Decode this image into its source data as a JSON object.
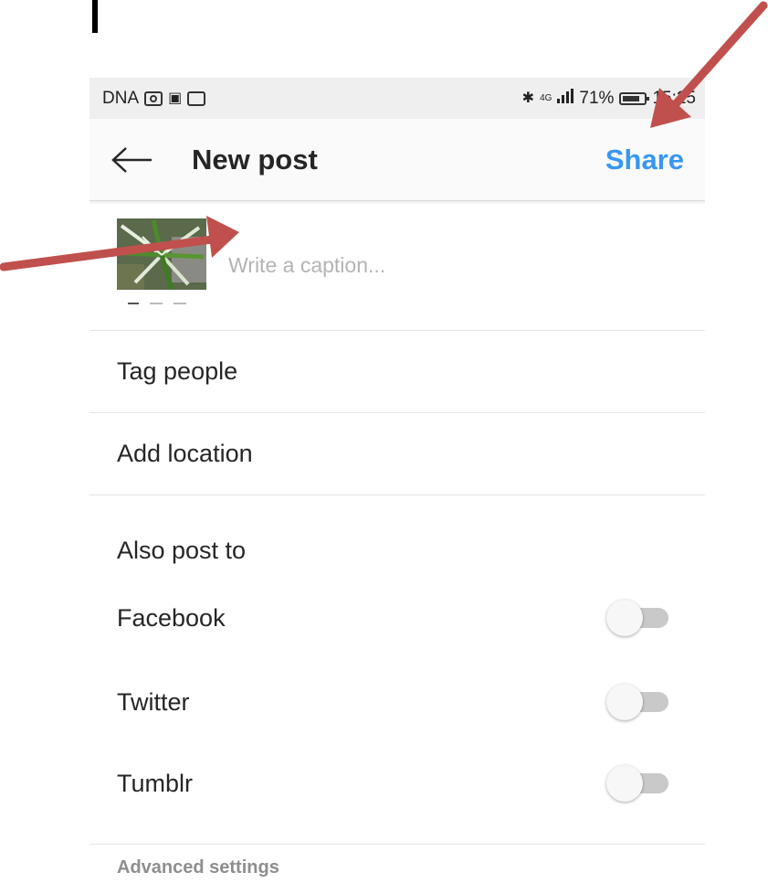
{
  "status_bar": {
    "carrier": "DNA",
    "network": "4G",
    "battery_percent": "71%",
    "time": "15:25",
    "icons": [
      "camera-icon",
      "vk-icon",
      "mail-icon",
      "bluetooth-icon",
      "signal-icon",
      "battery-icon"
    ]
  },
  "app_bar": {
    "back_icon": "arrow-left-icon",
    "title": "New post",
    "share_label": "Share"
  },
  "caption": {
    "placeholder": "Write a caption...",
    "value": ""
  },
  "rows": {
    "tag_people": "Tag people",
    "add_location": "Add location"
  },
  "also_post_to": {
    "heading": "Also post to",
    "items": [
      {
        "label": "Facebook",
        "enabled": false
      },
      {
        "label": "Twitter",
        "enabled": false
      },
      {
        "label": "Tumblr",
        "enabled": false
      }
    ]
  },
  "advanced_settings": "Advanced settings",
  "colors": {
    "accent": "#3897f0",
    "annotation_arrow": "#c0504d",
    "toggle_off_track": "#c9c9c9"
  }
}
